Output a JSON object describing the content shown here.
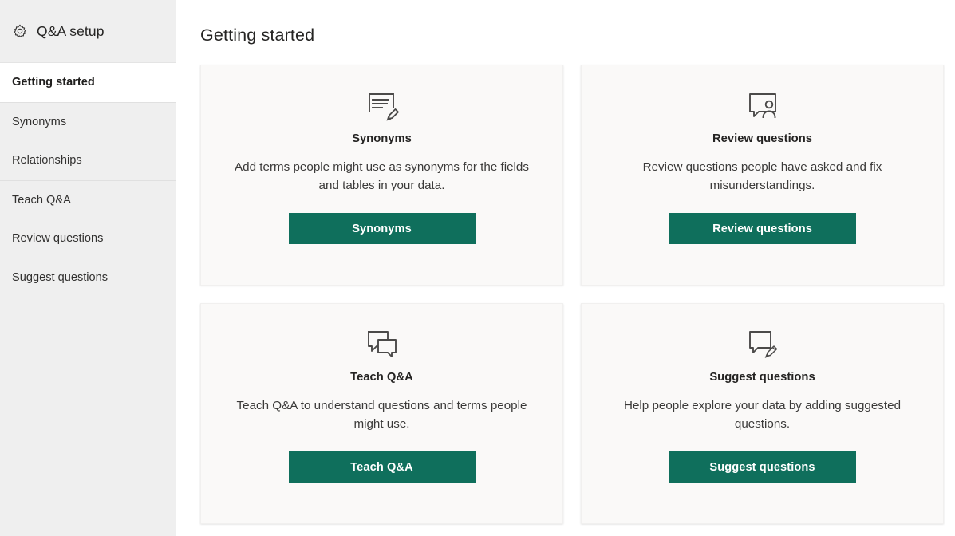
{
  "sidebar": {
    "icon": "gear-icon",
    "title": "Q&A setup",
    "groups": [
      {
        "items": [
          {
            "label": "Getting started",
            "active": true
          }
        ]
      },
      {
        "items": [
          {
            "label": "Synonyms",
            "active": false
          },
          {
            "label": "Relationships",
            "active": false
          }
        ]
      },
      {
        "items": [
          {
            "label": "Teach Q&A",
            "active": false
          },
          {
            "label": "Review questions",
            "active": false
          },
          {
            "label": "Suggest questions",
            "active": false
          }
        ]
      }
    ]
  },
  "main": {
    "page_title": "Getting started",
    "cards": [
      {
        "icon": "note-pencil-icon",
        "title": "Synonyms",
        "description": "Add terms people might use as synonyms for the fields and tables in your data.",
        "button_label": "Synonyms"
      },
      {
        "icon": "speech-bubble-person-icon",
        "title": "Review questions",
        "description": "Review questions people have asked and fix misunderstandings.",
        "button_label": "Review questions"
      },
      {
        "icon": "two-speech-bubbles-icon",
        "title": "Teach Q&A",
        "description": "Teach Q&A to understand questions and terms people might use.",
        "button_label": "Teach Q&A"
      },
      {
        "icon": "speech-bubble-pencil-icon",
        "title": "Suggest questions",
        "description": "Help people explore your data by adding suggested questions.",
        "button_label": "Suggest questions"
      }
    ]
  },
  "colors": {
    "accent": "#0f6f5c",
    "sidebar_bg": "#efefef",
    "card_bg": "#faf9f8",
    "text": "#252423"
  }
}
